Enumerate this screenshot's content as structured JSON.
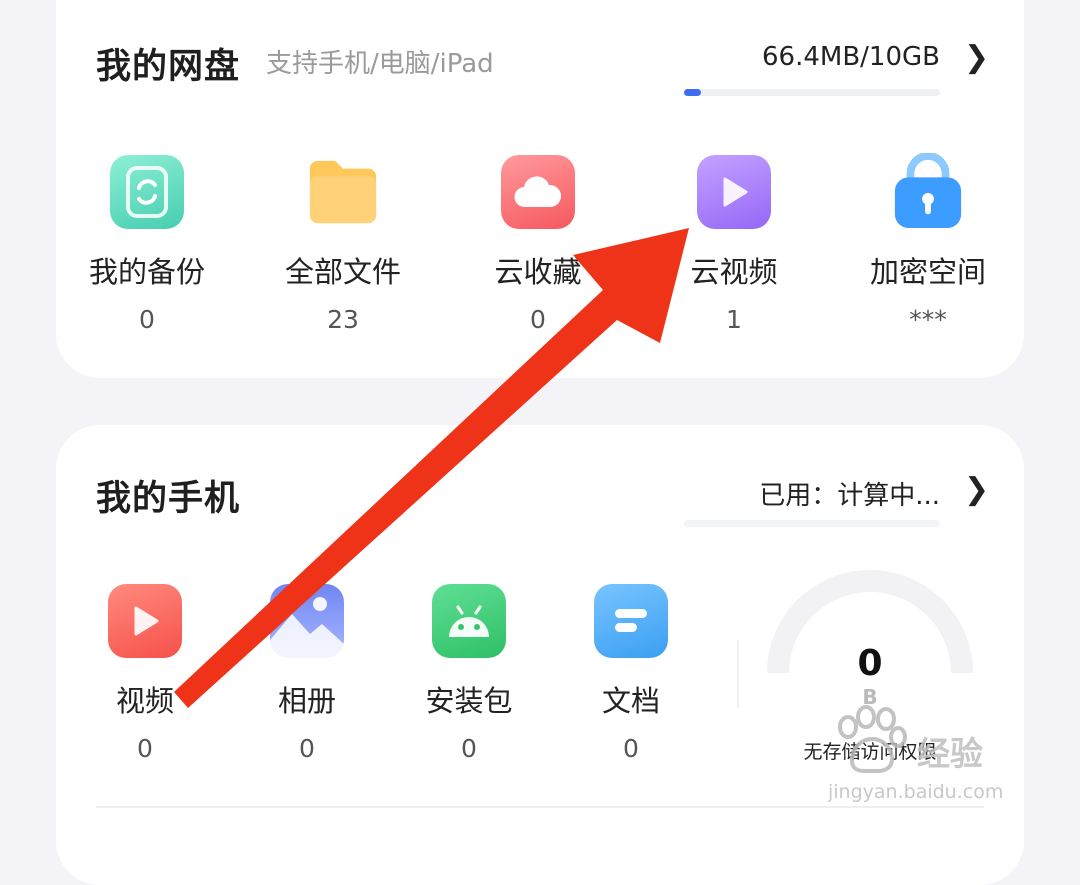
{
  "cloud_drive": {
    "title": "我的网盘",
    "subtitle": "支持手机/电脑/iPad",
    "usage": "66.4MB/10GB",
    "usage_fraction": 0.007,
    "chevron": "❯",
    "items": [
      {
        "label": "我的备份",
        "count": "0",
        "icon": "backup-icon",
        "color": "#4fd4b6"
      },
      {
        "label": "全部文件",
        "count": "23",
        "icon": "folder-icon",
        "color": "#ffc24f"
      },
      {
        "label": "云收藏",
        "count": "0",
        "icon": "cloud-favorite-icon",
        "color": "#f9686e"
      },
      {
        "label": "云视频",
        "count": "1",
        "icon": "video-play-icon",
        "color": "#a77bff"
      },
      {
        "label": "加密空间",
        "count": "***",
        "icon": "lock-icon",
        "color": "#3ea0ff"
      }
    ]
  },
  "my_phone": {
    "title": "我的手机",
    "usage": "已用：计算中...",
    "chevron": "❯",
    "items": [
      {
        "label": "视频",
        "count": "0",
        "icon": "video-icon",
        "color": "#f95c54"
      },
      {
        "label": "相册",
        "count": "0",
        "icon": "album-icon",
        "color": "#7f95f5"
      },
      {
        "label": "安装包",
        "count": "0",
        "icon": "android-package-icon",
        "color": "#3ccb75"
      },
      {
        "label": "文档",
        "count": "0",
        "icon": "document-icon",
        "color": "#41a8f5"
      }
    ],
    "gauge": {
      "value": "0",
      "unit": "B",
      "caption": "无存储访问权限"
    }
  },
  "watermark": {
    "brand": "经验",
    "url": "jingyan.baidu.com"
  },
  "annotation_color": "#ee3318"
}
